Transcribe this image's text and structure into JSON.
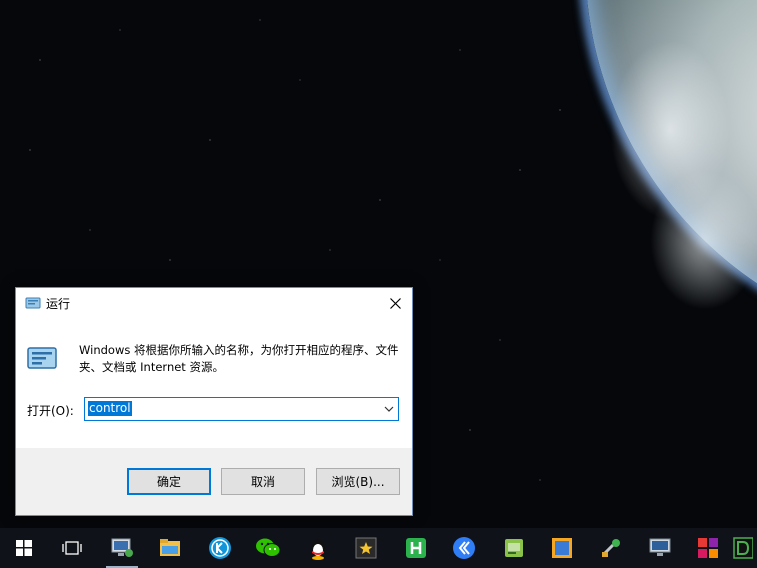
{
  "dialog": {
    "title": "运行",
    "description": "Windows 将根据你所输入的名称，为你打开相应的程序、文件夹、文档或 Internet 资源。",
    "open_label": "打开(O):",
    "input_value": "control",
    "buttons": {
      "ok": "确定",
      "cancel": "取消",
      "browse": "浏览(B)..."
    }
  },
  "taskbar": {
    "items": [
      {
        "icon": "windows-start-icon"
      },
      {
        "icon": "task-view-icon"
      },
      {
        "icon": "remote-computer-icon"
      },
      {
        "icon": "file-explorer-icon"
      },
      {
        "icon": "kugou-music-icon"
      },
      {
        "icon": "wechat-icon"
      },
      {
        "icon": "qq-penguin-icon"
      },
      {
        "icon": "star-app-icon"
      },
      {
        "icon": "hbuilder-icon"
      },
      {
        "icon": "browser-chevron-icon"
      },
      {
        "icon": "green-app-icon"
      },
      {
        "icon": "orange-window-icon"
      },
      {
        "icon": "tools-icon"
      },
      {
        "icon": "monitor-icon"
      },
      {
        "icon": "colored-squares-icon"
      },
      {
        "icon": "green-d-icon"
      }
    ]
  },
  "colors": {
    "accent": "#0078d7",
    "taskbar": "#0f1218"
  }
}
